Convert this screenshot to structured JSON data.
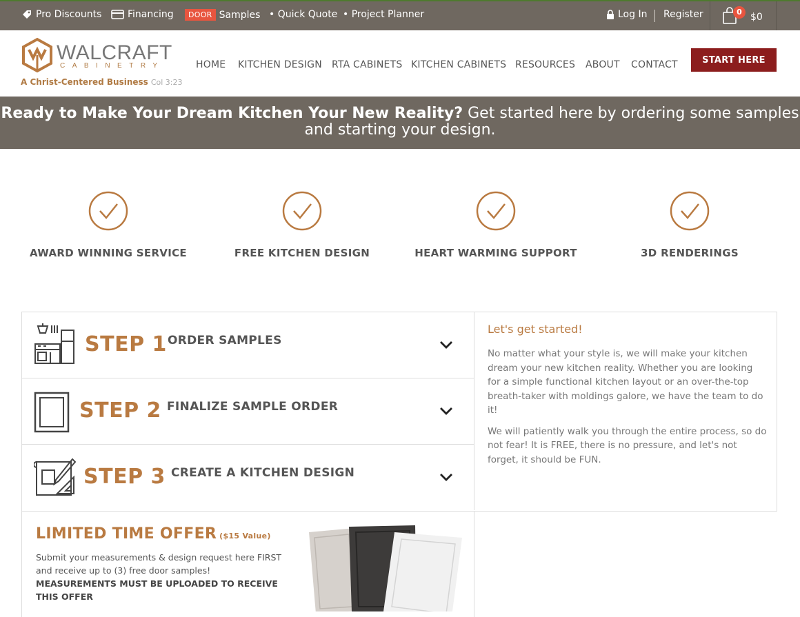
{
  "topbar": {
    "pro_discounts": "Pro Discounts",
    "financing": "Financing",
    "door_badge": "DOOR",
    "samples": "Samples",
    "quick_quote": "• Quick Quote",
    "project_planner": "• Project Planner",
    "login": "Log In",
    "register": "Register",
    "cart_count": "0",
    "cart_total": "$0"
  },
  "header": {
    "logo_word": "WALCRAFT",
    "logo_sub": "CABINETRY",
    "tagline": "A Christ-Centered Business",
    "tagline_ref": "Col 3:23",
    "nav": [
      "HOME",
      "KITCHEN DESIGN",
      "RTA CABINETS",
      "KITCHEN CABINETS",
      "RESOURCES",
      "ABOUT",
      "CONTACT"
    ],
    "cta": "START HERE"
  },
  "banner": {
    "bold": "Ready to Make Your Dream Kitchen Your New Reality?",
    "rest": " Get started here by ordering some samples and starting your design."
  },
  "features": [
    {
      "title": "AWARD WINNING SERVICE",
      "icon": "check-circle-icon"
    },
    {
      "title": "FREE KITCHEN DESIGN",
      "icon": "check-circle-icon"
    },
    {
      "title": "HEART WARMING SUPPORT",
      "icon": "check-circle-icon"
    },
    {
      "title": "3D RENDERINGS",
      "icon": "check-circle-icon"
    }
  ],
  "steps": [
    {
      "num": "STEP 1",
      "label": "ORDER SAMPLES",
      "icon": "kitchen-icon"
    },
    {
      "num": "STEP 2",
      "label": "FINALIZE SAMPLE ORDER",
      "icon": "door-panel-icon"
    },
    {
      "num": "STEP 3",
      "label": "CREATE A KITCHEN DESIGN",
      "icon": "blueprint-icon"
    }
  ],
  "right_panel": {
    "title": "Let's get started!",
    "p1": "No matter what your style is, we will make your kitchen dream your new kitchen reality. Whether you are looking for a simple functional kitchen layout or an over-the-top breath-taker with moldings galore, we have the team to do it!",
    "p2": "We will patiently walk you through the entire process, so do not fear! It is FREE, there is no pressure, and let's not forget, it should be FUN."
  },
  "offer": {
    "title": "LIMITED TIME OFFER",
    "value": "($15 Value)",
    "text": "Submit your measurements & design request here FIRST and receive up to (3) free door samples!",
    "bold": "MEASUREMENTS MUST BE UPLOADED TO RECEIVE THIS OFFER"
  },
  "colors": {
    "accent": "#b97a41",
    "bar": "#6f6860",
    "cta": "#8c1d1d",
    "badge": "#e8553f"
  }
}
